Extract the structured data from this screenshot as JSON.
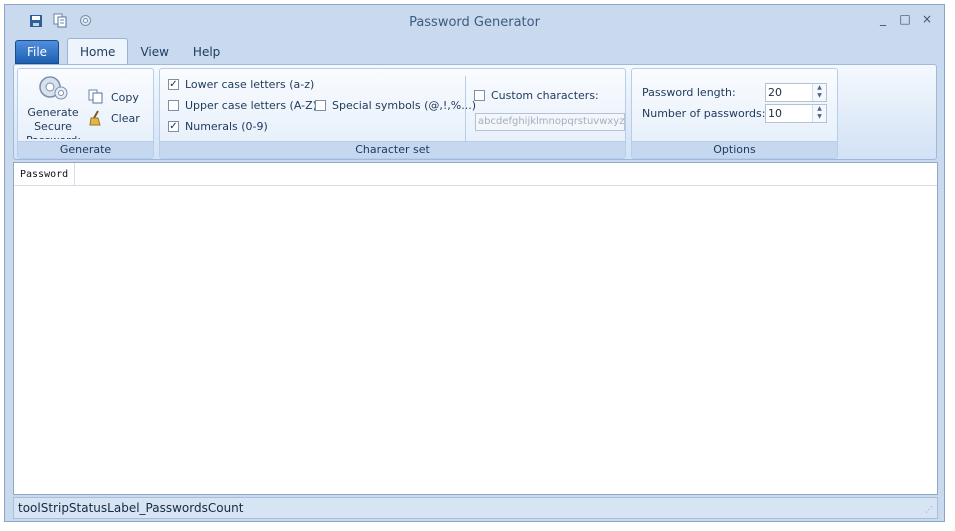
{
  "window": {
    "title": "Password Generator"
  },
  "quick_access": {
    "icons": [
      "save-icon",
      "copy-icon",
      "settings-icon"
    ]
  },
  "window_controls": {
    "minimize": "_",
    "maximize": "□",
    "close": "×"
  },
  "menu": {
    "file": "File",
    "tabs": [
      "Home",
      "View",
      "Help"
    ],
    "active_tab": "Home"
  },
  "ribbon": {
    "generate_group": {
      "label": "Generate",
      "generate_button": "Generate Secure Passwords",
      "copy_button": "Copy",
      "clear_button": "Clear"
    },
    "charset_group": {
      "label": "Character set",
      "options": [
        {
          "label": "Lower case letters (a-z)",
          "checked": true
        },
        {
          "label": "Upper case letters (A-Z)",
          "checked": false
        },
        {
          "label": "Numerals (0-9)",
          "checked": true
        },
        {
          "label": "Special symbols (@,!,%...)",
          "checked": false
        },
        {
          "label": "Custom characters:",
          "checked": false
        }
      ],
      "custom_value": "abcdefghijklmnopqrstuvwxyz"
    },
    "options_group": {
      "label": "Options",
      "password_length_label": "Password length:",
      "password_length": "20",
      "password_count_label": "Number of passwords:",
      "password_count": "10"
    }
  },
  "list": {
    "column_header": "Password",
    "rows": []
  },
  "status": {
    "text": "toolStripStatusLabel_PasswordsCount"
  },
  "colors": {
    "ribbon_background": "#dce8f7",
    "file_tab": "#1f5fb2",
    "frame": "#c9d9ee"
  }
}
